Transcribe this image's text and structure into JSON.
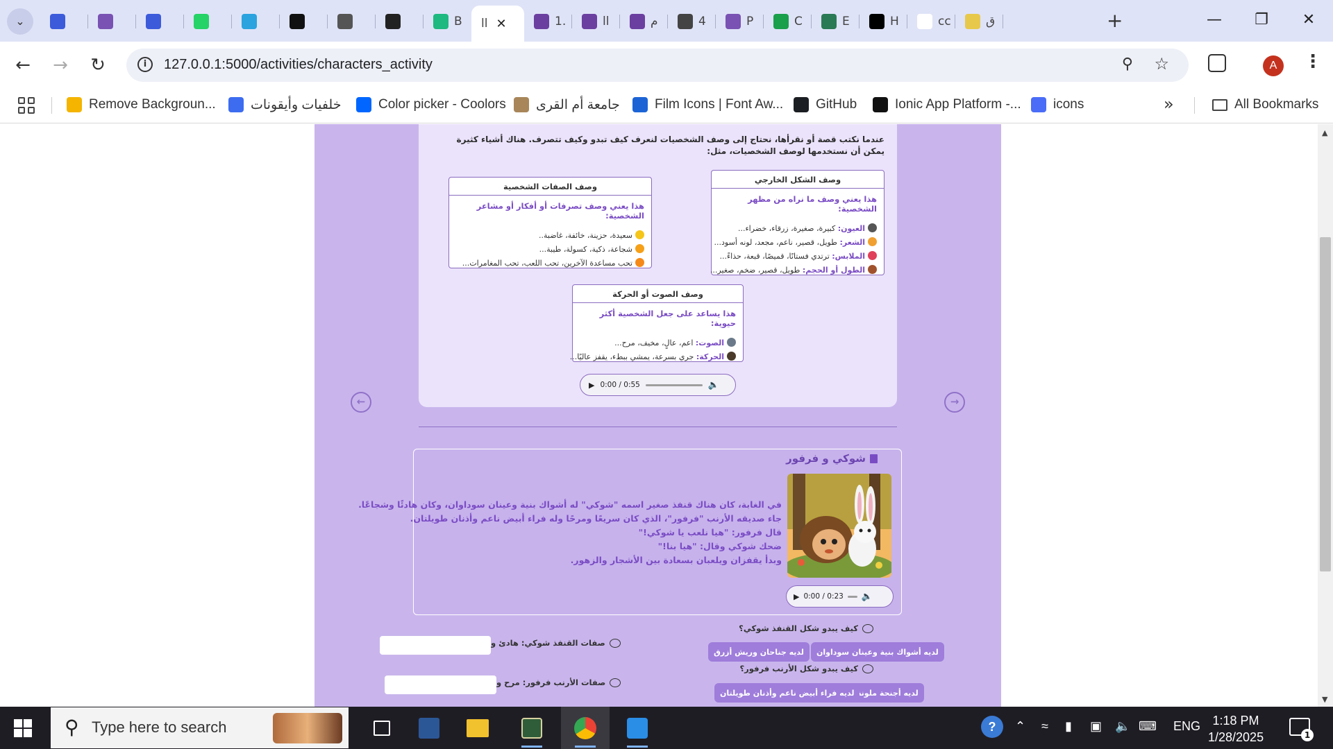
{
  "browser": {
    "tabs": [
      {
        "title": "",
        "icon": "zoom-magnifier-icon",
        "color": "#3b5bdb"
      },
      {
        "title": "",
        "icon": "bootstrap-icon",
        "color": "#7952b3"
      },
      {
        "title": "",
        "icon": "flag-icon",
        "color": "#3b5bdb"
      },
      {
        "title": "",
        "icon": "whatsapp-icon",
        "color": "#25d366"
      },
      {
        "title": "",
        "icon": "telegram-icon",
        "color": "#2aa3df"
      },
      {
        "title": "",
        "icon": "pause-icon",
        "color": "#111111"
      },
      {
        "title": "",
        "icon": "aperture-icon",
        "color": "#555555"
      },
      {
        "title": "",
        "icon": "openai-icon",
        "color": "#222222"
      },
      {
        "title": "B",
        "icon": "vuetify-icon",
        "color": "#1eb980"
      },
      {
        "title": "اا",
        "icon": "",
        "color": "#ffffff",
        "active": true
      },
      {
        "title": "1.",
        "icon": "page-icon",
        "color": "#6b3fa0"
      },
      {
        "title": "اا",
        "icon": "page-icon",
        "color": "#6b3fa0"
      },
      {
        "title": "م",
        "icon": "page-icon",
        "color": "#6b3fa0"
      },
      {
        "title": "4",
        "icon": "globe-icon",
        "color": "#444444"
      },
      {
        "title": "P",
        "icon": "bootstrap-icon",
        "color": "#7952b3"
      },
      {
        "title": "C",
        "icon": "w3c-icon",
        "color": "#1a9f4b"
      },
      {
        "title": "E",
        "icon": "notebook-icon",
        "color": "#2a7a55"
      },
      {
        "title": "H",
        "icon": "x-icon",
        "color": "#000000"
      },
      {
        "title": "cc",
        "icon": "google-icon",
        "color": "#ffffff"
      },
      {
        "title": "ق",
        "icon": "image-icon",
        "color": "#e8c84a"
      }
    ],
    "url": "127.0.0.1:5000/activities/characters_activity",
    "avatar_letter": "A",
    "bookmarks": [
      {
        "label": "Remove Backgroun...",
        "icon": "removebg-icon",
        "color": "#f4b400"
      },
      {
        "label": "خلفيات وأيقونات",
        "icon": "freepik-icon",
        "color": "#3d6cf0"
      },
      {
        "label": "Color picker - Coolors",
        "icon": "coolors-icon",
        "color": "#0066ff"
      },
      {
        "label": "جامعة أم القرى",
        "icon": "uqu-icon",
        "color": "#a8865a"
      },
      {
        "label": "Film Icons | Font Aw...",
        "icon": "fontawesome-flag-icon",
        "color": "#1c64d6"
      },
      {
        "label": "GitHub",
        "icon": "github-icon",
        "color": "#1b1f23"
      },
      {
        "label": "Ionic App Platform -...",
        "icon": "ionic-icon",
        "color": "#111111"
      },
      {
        "label": "icons",
        "icon": "icons8-icon",
        "color": "#4a6cf7"
      }
    ],
    "all_bookmarks_label": "All Bookmarks"
  },
  "activity": {
    "intro": "عندما نكتب قصة أو نقرأها، نحتاج إلى وصف الشخصيات لنعرف كيف تبدو وكيف تتصرف. هناك أشياء كثيرة يمكن أن نستخدمها لوصف الشخصيات، مثل:",
    "appearance": {
      "title": "وصف الشكل الخارجي",
      "subtitle": "هذا يعني وصف ما نراه من مظهر الشخصية:",
      "items": [
        {
          "key": "العيون:",
          "value": "كبيرة، صغيرة، زرقاء، خضراء...",
          "icon": "eye-icon",
          "color": "#555555"
        },
        {
          "key": "الشعر:",
          "value": "طويل، قصير، ناعم، مجعد، لونه أسود...",
          "icon": "hair-emoji-icon",
          "color": "#f0a030"
        },
        {
          "key": "الملابس:",
          "value": "ترتدي فستانًا، قميصًا، قبعة، حذاءً...",
          "icon": "dress-emoji-icon",
          "color": "#e0405a"
        },
        {
          "key": "الطول أو الحجم:",
          "value": "طويل، قصير، ضخم، صغير...",
          "icon": "person-emoji-icon",
          "color": "#a0522d"
        }
      ]
    },
    "personality": {
      "title": "وصف الصفات الشخصية",
      "subtitle": "هذا يعني وصف تصرفات أو أفكار أو مشاعر الشخصية:",
      "items": [
        {
          "key": "",
          "value": "سعيدة، حزينة، خائفة، غاضبة..",
          "icon": "smile-emoji-icon",
          "color": "#f5c518"
        },
        {
          "key": "",
          "value": "شجاعة، ذكية، كسولة، طيبة...",
          "icon": "cool-emoji-icon",
          "color": "#f5a018"
        },
        {
          "key": "",
          "value": "تحب مساعدة الآخرين، تحب اللعب، تحب المغامرات...",
          "icon": "heart-eyes-emoji-icon",
          "color": "#f58a18"
        }
      ]
    },
    "voice": {
      "title": "وصف الصوت أو الحركة",
      "subtitle": "هذا يساعد على جعل الشخصية أكثر حيوية:",
      "items": [
        {
          "key": "الصوت:",
          "value": "اعم، عالٍ، مخيف، مرح...",
          "icon": "speaker-emoji-icon",
          "color": "#6b7a8a"
        },
        {
          "key": "الحركة:",
          "value": "جري بسرعة، يمشي ببطء، يقفز عاليًا...",
          "icon": "running-emoji-icon",
          "color": "#4a3a2a"
        }
      ]
    },
    "audio_main": {
      "time": "0:00 / 0:55",
      "progress": 0
    },
    "story": {
      "title": "شوكي و فرفور",
      "lines": [
        "في الغابة، كان هناك قنفذ صغير اسمه \"شوكي\" له أشواك بنية وعينان سوداوان، وكان هادئًا وشجاعًا.",
        "جاء صديقه الأرنب \"فرفور\"، الذي كان سريعًا ومرحًا وله فراء أبيض ناعم وأذنان طويلتان.",
        "قال فرفور: \"هيا نلعب يا شوكي!\"",
        "ضحك شوكي وقال: \"هيا بنا!\"",
        "وبدأ يقفزان ويلعبان بسعادة بين الأشجار والزهور."
      ],
      "audio": {
        "time": "0:00 / 0:23",
        "progress": 0
      }
    },
    "questions": [
      {
        "label": "كيف يبدو شكل القنفذ شوكي؟",
        "options": [
          "لديه أشواك بنية وعينان سوداوان",
          "لديه جناحان وريش أزرق"
        ]
      },
      {
        "label": "كيف يبدو شكل الأرنب فرفور؟",
        "options": [
          "لديه أجنحة ملونة",
          "لديه فراء أبيض ناعم وأذنان طويلتان"
        ]
      }
    ],
    "traits": [
      {
        "label": "صفات القنفذ شوكي: هادئ و",
        "value": ""
      },
      {
        "label": "صفات الأرنب فرفور: مرح و",
        "value": ""
      }
    ]
  },
  "taskbar": {
    "search_placeholder": "Type here to search",
    "apps": [
      "task-view-icon",
      "word-icon",
      "file-explorer-icon",
      "cursor-app-icon",
      "chrome-icon",
      "vscode-icon"
    ],
    "lang": "ENG",
    "time": "1:18 PM",
    "date": "1/28/2025",
    "notifications": "1"
  }
}
